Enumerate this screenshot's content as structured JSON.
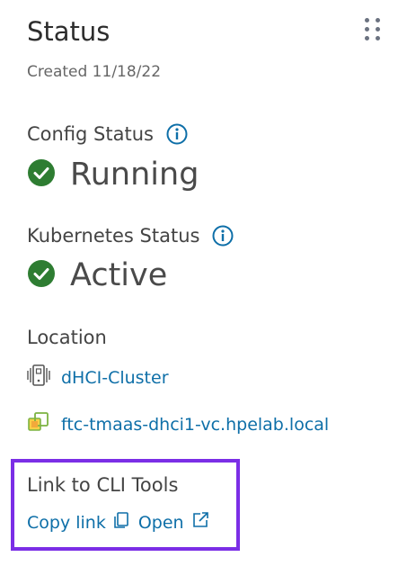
{
  "header": {
    "title": "Status",
    "created": "Created 11/18/22",
    "menu_icon": "kebab-menu-icon"
  },
  "config": {
    "label": "Config Status",
    "value": "Running",
    "icon": "check-circle-icon"
  },
  "kubernetes": {
    "label": "Kubernetes Status",
    "value": "Active",
    "icon": "check-circle-icon"
  },
  "location": {
    "label": "Location",
    "items": [
      {
        "text": "dHCI-Cluster",
        "icon": "cluster-icon"
      },
      {
        "text": "ftc-tmaas-dhci1-vc.hpelab.local",
        "icon": "vcenter-icon"
      }
    ]
  },
  "cli_tools": {
    "label": "Link to CLI Tools",
    "copy_label": "Copy link",
    "open_label": "Open"
  },
  "colors": {
    "accent": "#0e6fa8",
    "success": "#2e7d32",
    "highlight": "#7b2ee6"
  }
}
